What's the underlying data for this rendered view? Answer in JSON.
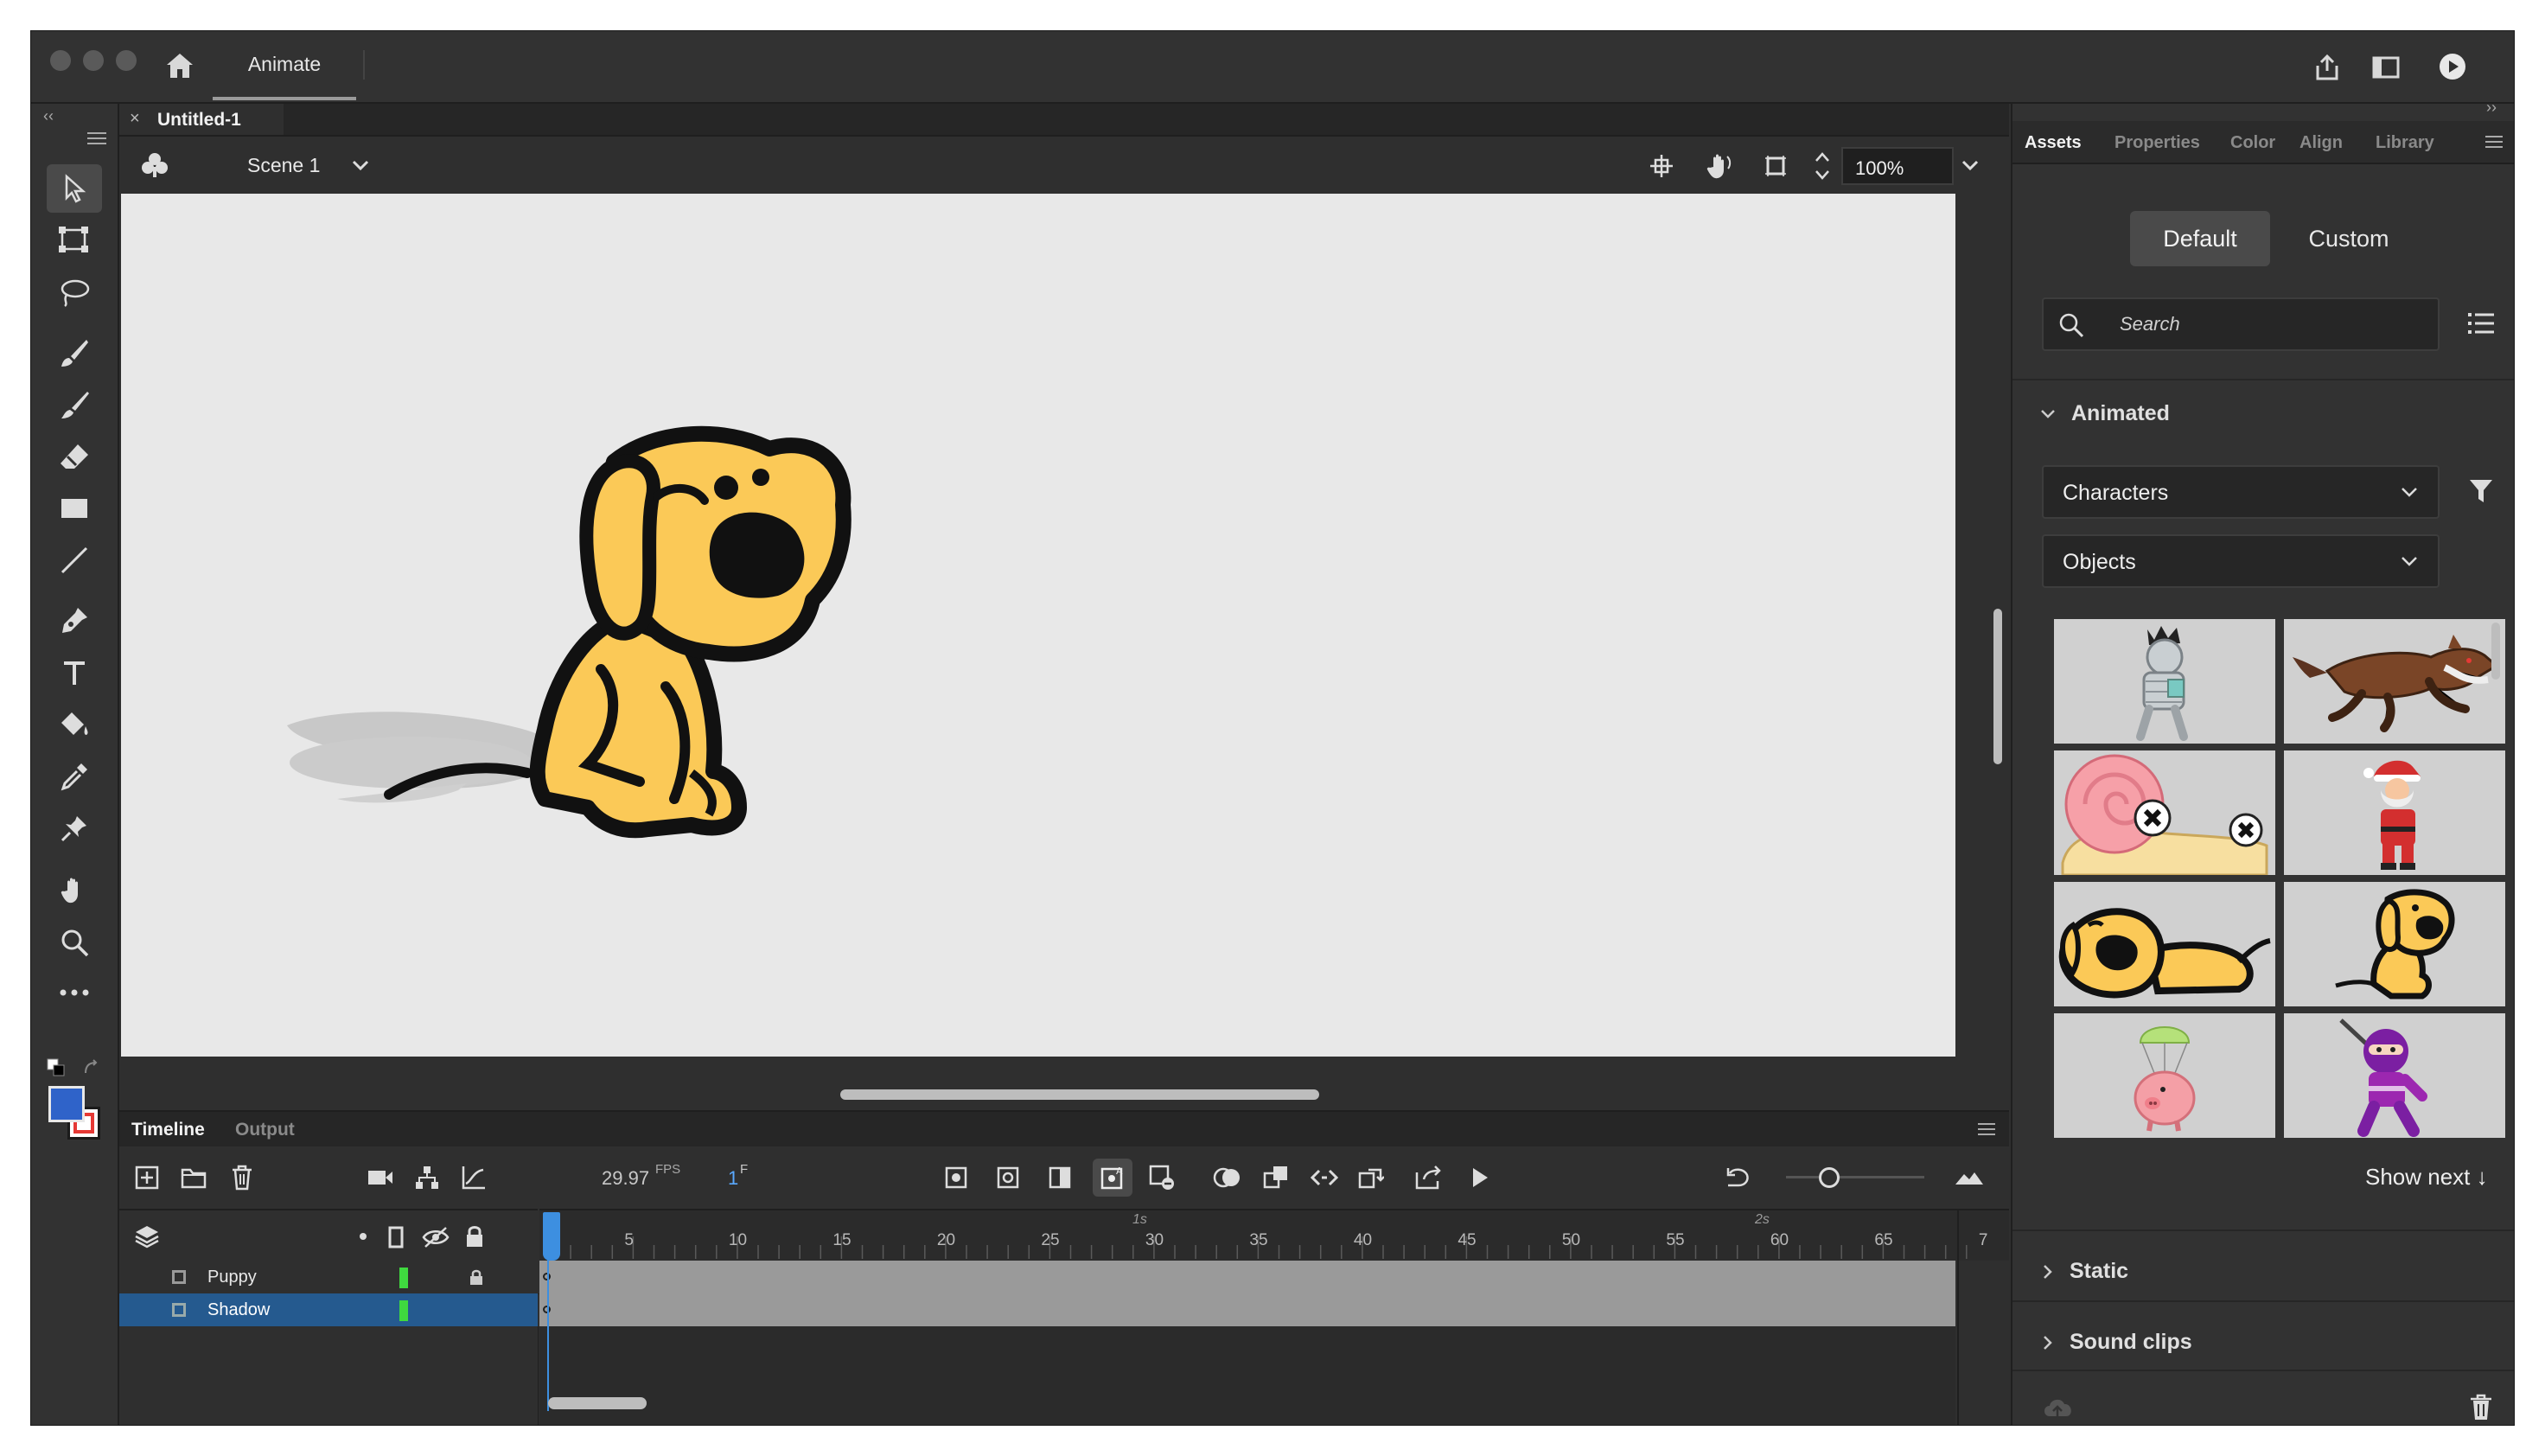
{
  "app": {
    "home_tab_label": "Animate"
  },
  "document": {
    "tab_title": "Untitled-1"
  },
  "stage_header": {
    "scene_label": "Scene 1",
    "zoom_value": "100%"
  },
  "panels": {
    "tabs": [
      "Assets",
      "Properties",
      "Color",
      "Align",
      "Library"
    ],
    "active_tab": "Assets"
  },
  "assets": {
    "toggle_default": "Default",
    "toggle_custom": "Custom",
    "search_placeholder": "Search",
    "section_animated": "Animated",
    "dropdown_characters": "Characters",
    "dropdown_objects": "Objects",
    "show_next": "Show next ↓",
    "section_static": "Static",
    "section_sound": "Sound clips",
    "thumbnails": [
      "mummy",
      "werewolf",
      "snail",
      "santa",
      "sleeping-puppy",
      "sitting-puppy",
      "parachute-pig",
      "ninja"
    ]
  },
  "timeline": {
    "tab_timeline": "Timeline",
    "tab_output": "Output",
    "fps_value": "29.97",
    "fps_unit": "FPS",
    "frame_value": "1",
    "frame_unit": "F",
    "ruler_numbers": [
      "5",
      "10",
      "15",
      "20",
      "25",
      "30",
      "35",
      "40",
      "45",
      "50",
      "55",
      "60",
      "65",
      "7"
    ],
    "second_markers": [
      "1s",
      "2s"
    ],
    "layers": [
      {
        "name": "Puppy",
        "selected": false,
        "locked": true
      },
      {
        "name": "Shadow",
        "selected": true,
        "locked": false
      }
    ]
  },
  "colors": {
    "stroke_color": "#e53935",
    "fill_color": "#2f63c9",
    "accent": "#3d8fe0",
    "layer_marker": "#3fd93f",
    "puppy_fill": "#fbc957"
  }
}
